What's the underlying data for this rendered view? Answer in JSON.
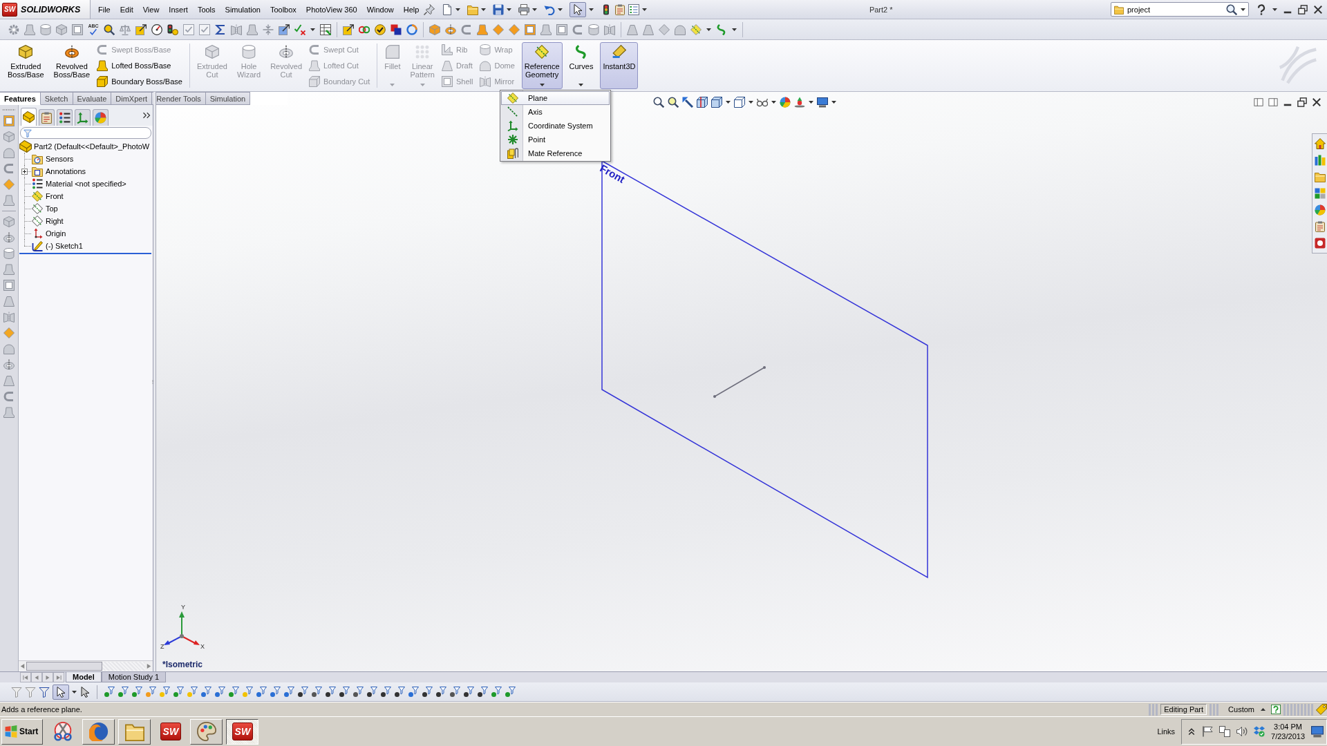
{
  "logo": {
    "badge": "SW",
    "wordmark": "SOLIDWORKS"
  },
  "menu_bar": [
    "File",
    "Edit",
    "View",
    "Insert",
    "Tools",
    "Simulation",
    "Toolbox",
    "PhotoView 360",
    "Window",
    "Help"
  ],
  "standard_toolbar": {
    "select_pressed": true,
    "spell_check": "ABC"
  },
  "document_title": "Part2 *",
  "search": {
    "value": "project"
  },
  "ribbon": {
    "groups": [
      {
        "items": [
          {
            "kind": "large",
            "label": "Extruded Boss/Base",
            "disabled": false,
            "active": false,
            "has_menu": false
          },
          {
            "kind": "large",
            "label": "Revolved Boss/Base",
            "disabled": false,
            "active": false,
            "has_menu": false
          },
          {
            "kind": "stack",
            "buttons": [
              {
                "label": "Swept Boss/Base",
                "disabled": true
              },
              {
                "label": "Lofted Boss/Base",
                "disabled": false
              },
              {
                "label": "Boundary Boss/Base",
                "disabled": false
              }
            ]
          }
        ]
      },
      {
        "items": [
          {
            "kind": "large",
            "label": "Extruded Cut",
            "disabled": true,
            "active": false,
            "has_menu": false
          },
          {
            "kind": "large",
            "label": "Hole Wizard",
            "disabled": true,
            "active": false,
            "has_menu": false
          },
          {
            "kind": "large",
            "label": "Revolved Cut",
            "disabled": true,
            "active": false,
            "has_menu": false
          },
          {
            "kind": "stack",
            "buttons": [
              {
                "label": "Swept Cut",
                "disabled": true
              },
              {
                "label": "Lofted Cut",
                "disabled": true
              },
              {
                "label": "Boundary Cut",
                "disabled": true
              }
            ]
          }
        ]
      },
      {
        "items": [
          {
            "kind": "large",
            "label": "Fillet",
            "disabled": true,
            "active": false,
            "has_menu": true
          },
          {
            "kind": "large",
            "label": "Linear Pattern",
            "disabled": true,
            "active": false,
            "has_menu": true
          },
          {
            "kind": "stack",
            "buttons": [
              {
                "label": "Rib",
                "disabled": true
              },
              {
                "label": "Draft",
                "disabled": true
              },
              {
                "label": "Shell",
                "disabled": true
              }
            ]
          },
          {
            "kind": "stack",
            "buttons": [
              {
                "label": "Wrap",
                "disabled": true
              },
              {
                "label": "Dome",
                "disabled": true
              },
              {
                "label": "Mirror",
                "disabled": true
              }
            ]
          },
          {
            "kind": "large",
            "label": "Reference Geometry",
            "disabled": false,
            "active": true,
            "has_menu": true
          },
          {
            "kind": "large",
            "label": "Curves",
            "disabled": false,
            "active": false,
            "has_menu": true
          },
          {
            "kind": "large",
            "label": "Instant3D",
            "disabled": false,
            "active": true,
            "has_menu": false
          }
        ]
      }
    ]
  },
  "command_tabs": [
    {
      "label": "Features",
      "selected": true
    },
    {
      "label": "Sketch",
      "selected": false
    },
    {
      "label": "Evaluate",
      "selected": false
    },
    {
      "label": "DimXpert",
      "selected": false
    },
    {
      "label": "Render Tools",
      "selected": false
    },
    {
      "label": "Simulation",
      "selected": false
    }
  ],
  "feature_manager_tabs": [
    {
      "selected": true
    },
    {
      "selected": false
    },
    {
      "selected": false
    },
    {
      "selected": false
    },
    {
      "selected": false
    }
  ],
  "feature_tree": {
    "root": {
      "label": "Part2 (Default<<Default>_PhotoW",
      "kind": "part",
      "children": [
        {
          "label": "Sensors",
          "kind": "sensors"
        },
        {
          "label": "Annotations",
          "kind": "annotations",
          "expanded": false
        },
        {
          "label": "Material <not specified>",
          "kind": "material"
        },
        {
          "label": "Front",
          "kind": "plane",
          "shown": true
        },
        {
          "label": "Top",
          "kind": "plane",
          "shown": false
        },
        {
          "label": "Right",
          "kind": "plane",
          "shown": false
        },
        {
          "label": "Origin",
          "kind": "origin"
        },
        {
          "label": "(-) Sketch1",
          "kind": "sketch"
        }
      ]
    }
  },
  "reference_geometry_menu": [
    {
      "label": "Plane",
      "kind": "plane",
      "highlighted": true
    },
    {
      "label": "Axis",
      "kind": "axis",
      "highlighted": false
    },
    {
      "label": "Coordinate System",
      "kind": "coordinate_system",
      "highlighted": false
    },
    {
      "label": "Point",
      "kind": "point",
      "highlighted": false
    },
    {
      "label": "Mate Reference",
      "kind": "mate_reference",
      "highlighted": false
    }
  ],
  "viewport": {
    "plane_label": "Front",
    "view_name": "*Isometric",
    "triad": [
      "Y",
      "X",
      "Z"
    ]
  },
  "model_tabs": [
    {
      "label": "Model",
      "selected": true
    },
    {
      "label": "Motion Study 1",
      "selected": false
    }
  ],
  "selection_filter_toolbar": {
    "select_pressed": true
  },
  "status_bar": {
    "message": "Adds a reference plane.",
    "mode": "Editing Part",
    "units": "Custom"
  },
  "taskbar": {
    "start": "Start",
    "apps": [
      {
        "kind": "snipping",
        "running": false,
        "selected": false
      },
      {
        "kind": "browser",
        "running": true,
        "selected": false
      },
      {
        "kind": "explorer",
        "running": true,
        "selected": false
      },
      {
        "kind": "solidworks",
        "label": "SW",
        "running": false,
        "selected": false
      },
      {
        "kind": "paint",
        "running": true,
        "selected": false
      },
      {
        "kind": "solidworks",
        "label": "SW",
        "running": true,
        "selected": true
      }
    ],
    "links": "Links",
    "time": "3:04 PM",
    "date": "7/23/2013"
  }
}
